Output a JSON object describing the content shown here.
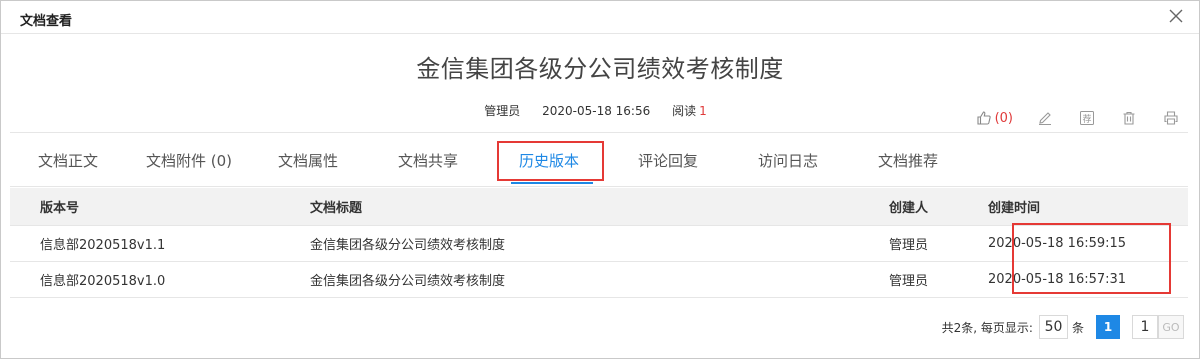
{
  "dialog": {
    "title": "文档查看",
    "close_icon": "close-icon"
  },
  "document": {
    "title": "金信集团各级分公司绩效考核制度",
    "author": "管理员",
    "datetime": "2020-05-18 16:56",
    "read_label": "阅读",
    "read_count": "1"
  },
  "actions": {
    "like_count": "(0)",
    "icons": [
      "thumbs-up-icon",
      "edit-icon",
      "recommend-icon",
      "delete-icon",
      "print-icon"
    ],
    "recommend_glyph": "荐"
  },
  "tabs": [
    {
      "label": "文档正文"
    },
    {
      "label": "文档附件 (0)"
    },
    {
      "label": "文档属性"
    },
    {
      "label": "文档共享"
    },
    {
      "label": "历史版本",
      "active": true
    },
    {
      "label": "评论回复"
    },
    {
      "label": "访问日志"
    },
    {
      "label": "文档推荐"
    }
  ],
  "table": {
    "headers": [
      "版本号",
      "文档标题",
      "创建人",
      "创建时间"
    ],
    "rows": [
      [
        "信息部2020518v1.1",
        "金信集团各级分公司绩效考核制度",
        "管理员",
        "2020-05-18 16:59:15"
      ],
      [
        "信息部2020518v1.0",
        "金信集团各级分公司绩效考核制度",
        "管理员",
        "2020-05-18 16:57:31"
      ]
    ]
  },
  "pager": {
    "summary": "共2条, 每页显示:",
    "page_size": "50",
    "unit": "条",
    "current_page": "1",
    "goto_value": "1",
    "go_label": "GO"
  },
  "colors": {
    "accent": "#1e88e5",
    "highlight": "#e53935",
    "count_red": "#e03a3a"
  }
}
